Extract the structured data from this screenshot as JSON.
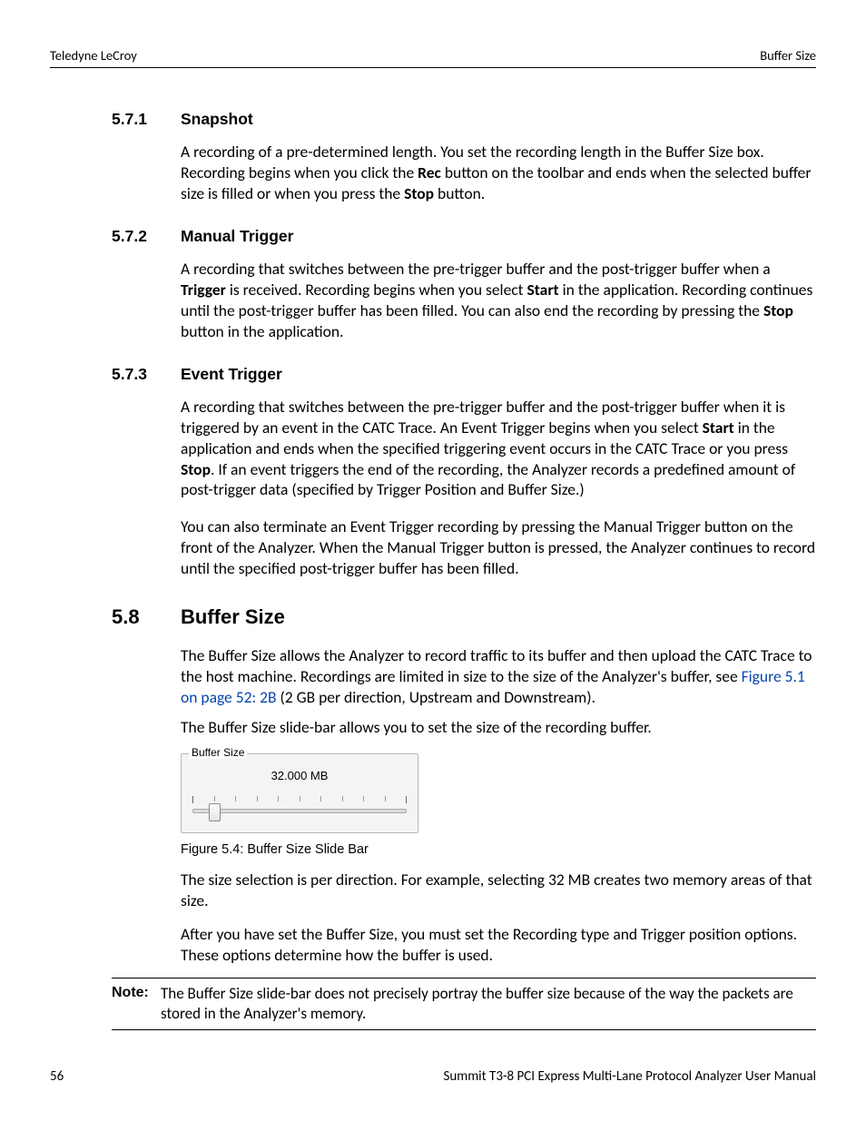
{
  "header": {
    "left": "Teledyne LeCroy",
    "right": "Buffer Size"
  },
  "sections": {
    "s571": {
      "num": "5.7.1",
      "title": "Snapshot",
      "p1a": "A recording of a pre-determined length. You set the recording length in the Buffer Size box. Recording begins when you click the ",
      "p1b": "Rec",
      "p1c": " button on the toolbar and ends when the selected buffer size is filled or when you press the ",
      "p1d": "Stop",
      "p1e": " button."
    },
    "s572": {
      "num": "5.7.2",
      "title": "Manual Trigger",
      "p1a": "A recording that switches between the pre-trigger buffer and the post-trigger buffer when a ",
      "p1b": "Trigger",
      "p1c": " is received. Recording begins when you select ",
      "p1d": "Start",
      "p1e": " in the application. Recording continues until the post-trigger buffer has been filled. You can also end the recording by pressing the ",
      "p1f": "Stop",
      "p1g": " button in the application."
    },
    "s573": {
      "num": "5.7.3",
      "title": "Event Trigger",
      "p1a": "A recording that switches between the pre-trigger buffer and the post-trigger buffer when it is triggered by an event in the CATC Trace. An Event Trigger begins when you select ",
      "p1b": "Start",
      "p1c": " in the application and ends when the specified triggering event occurs in the CATC Trace or you press ",
      "p1d": "Stop",
      "p1e": ". If an event triggers the end of the recording, the Analyzer records a predefined amount of post-trigger data (specified by Trigger Position and Buffer Size.)",
      "p2": "You can also terminate an Event Trigger recording by pressing the Manual Trigger button on the front of the Analyzer. When the Manual Trigger button is pressed, the Analyzer continues to record until the specified post-trigger buffer has been filled."
    },
    "s58": {
      "num": "5.8",
      "title": "Buffer Size",
      "p1a": "The Buffer Size allows the Analyzer to record traffic to its buffer and then upload the CATC Trace to the host machine. Recordings are limited in size to the size of the Analyzer's buffer, see ",
      "p1link": "Figure 5.1 on page 52: 2B",
      "p1b": " (2 GB per direction, Upstream and Downstream).",
      "p2": "The Buffer Size slide-bar allows you to set the size of the recording buffer.",
      "fig": {
        "groupLabel": "Buffer Size",
        "valueText": "32.000 MB",
        "caption": "Figure 5.4:  Buffer Size Slide Bar"
      },
      "p3": "The size selection is per direction. For example, selecting 32 MB creates two memory areas of that size.",
      "p4": "After you have set the Buffer Size, you must set the Recording type and Trigger position options. These options determine how the buffer is used."
    }
  },
  "note": {
    "label": "Note:",
    "text": "The Buffer Size slide-bar does not precisely portray the buffer size because of the way the packets are stored in the Analyzer's memory."
  },
  "footer": {
    "pageNum": "56",
    "docTitle": "Summit T3-8 PCI Express Multi-Lane Protocol Analyzer User Manual"
  }
}
